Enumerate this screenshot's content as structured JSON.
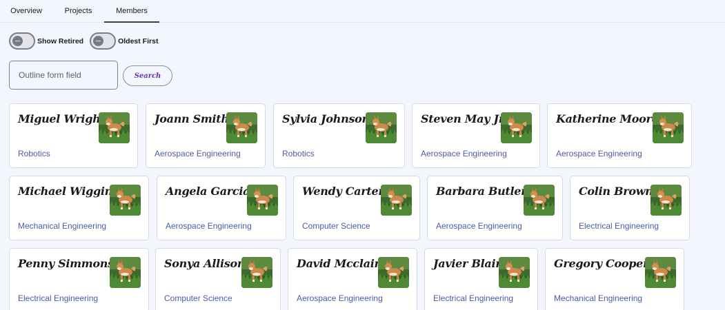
{
  "tabs": [
    {
      "label": "Overview",
      "active": false
    },
    {
      "label": "Projects",
      "active": false
    },
    {
      "label": "Members",
      "active": true
    }
  ],
  "toggles": {
    "show_retired": {
      "label": "Show Retired",
      "on": false
    },
    "oldest_first": {
      "label": "Oldest First",
      "on": false
    }
  },
  "search": {
    "placeholder": "Outline form field",
    "value": "",
    "button_label": "Search"
  },
  "members": [
    {
      "name": "Miguel Wright",
      "department": "Robotics"
    },
    {
      "name": "Joann Smith",
      "department": "Aerospace Engineering"
    },
    {
      "name": "Sylvia Johnson",
      "department": "Robotics"
    },
    {
      "name": "Steven May Jr.",
      "department": "Aerospace Engineering"
    },
    {
      "name": "Katherine Moore",
      "department": "Aerospace Engineering"
    },
    {
      "name": "Michael Wiggins",
      "department": "Mechanical Engineering"
    },
    {
      "name": "Angela Garcia",
      "department": "Aerospace Engineering"
    },
    {
      "name": "Wendy Carter",
      "department": "Computer Science"
    },
    {
      "name": "Barbara Butler",
      "department": "Aerospace Engineering"
    },
    {
      "name": "Colin Brown",
      "department": "Electrical Engineering"
    },
    {
      "name": "Penny Simmons",
      "department": "Electrical Engineering"
    },
    {
      "name": "Sonya Allison",
      "department": "Computer Science"
    },
    {
      "name": "David Mcclain",
      "department": "Aerospace Engineering"
    },
    {
      "name": "Javier Blair",
      "department": "Electrical Engineering"
    },
    {
      "name": "Gregory Cooper",
      "department": "Mechanical Engineering"
    }
  ],
  "colors": {
    "background": "#f4f6fd",
    "department_text": "#4d5ba5",
    "search_button_text": "#6b2ebd"
  },
  "icons": {
    "member_photo": "dog-photo"
  }
}
